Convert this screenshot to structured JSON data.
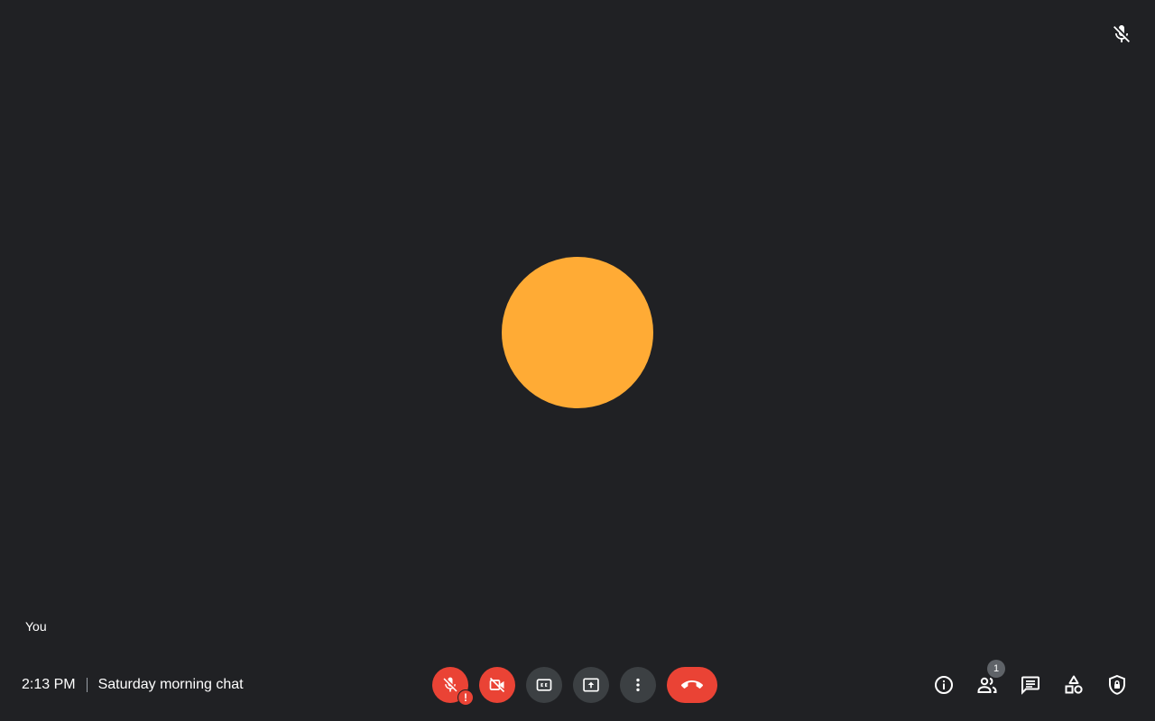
{
  "colors": {
    "background": "#202124",
    "avatar": "#ffab35",
    "danger": "#ea4335",
    "control_neutral": "#3c4043",
    "badge": "#5f6368"
  },
  "tile": {
    "top_right_icon": "mic-off-icon",
    "self_label": "You"
  },
  "meeting": {
    "time": "2:13 PM",
    "title": "Saturday morning chat"
  },
  "controls": {
    "mic": {
      "icon": "mic-off-icon",
      "alert": "!"
    },
    "camera": {
      "icon": "videocam-off-icon"
    },
    "captions": {
      "icon": "closed-caption-icon"
    },
    "present": {
      "icon": "present-to-all-icon"
    },
    "more": {
      "icon": "more-vert-icon"
    },
    "hangup": {
      "icon": "call-end-icon"
    }
  },
  "tools": {
    "info": {
      "icon": "info-icon"
    },
    "people": {
      "icon": "people-icon",
      "count": "1"
    },
    "chat": {
      "icon": "chat-icon"
    },
    "activities": {
      "icon": "shapes-icon"
    },
    "host_controls": {
      "icon": "shield-lock-icon"
    }
  }
}
